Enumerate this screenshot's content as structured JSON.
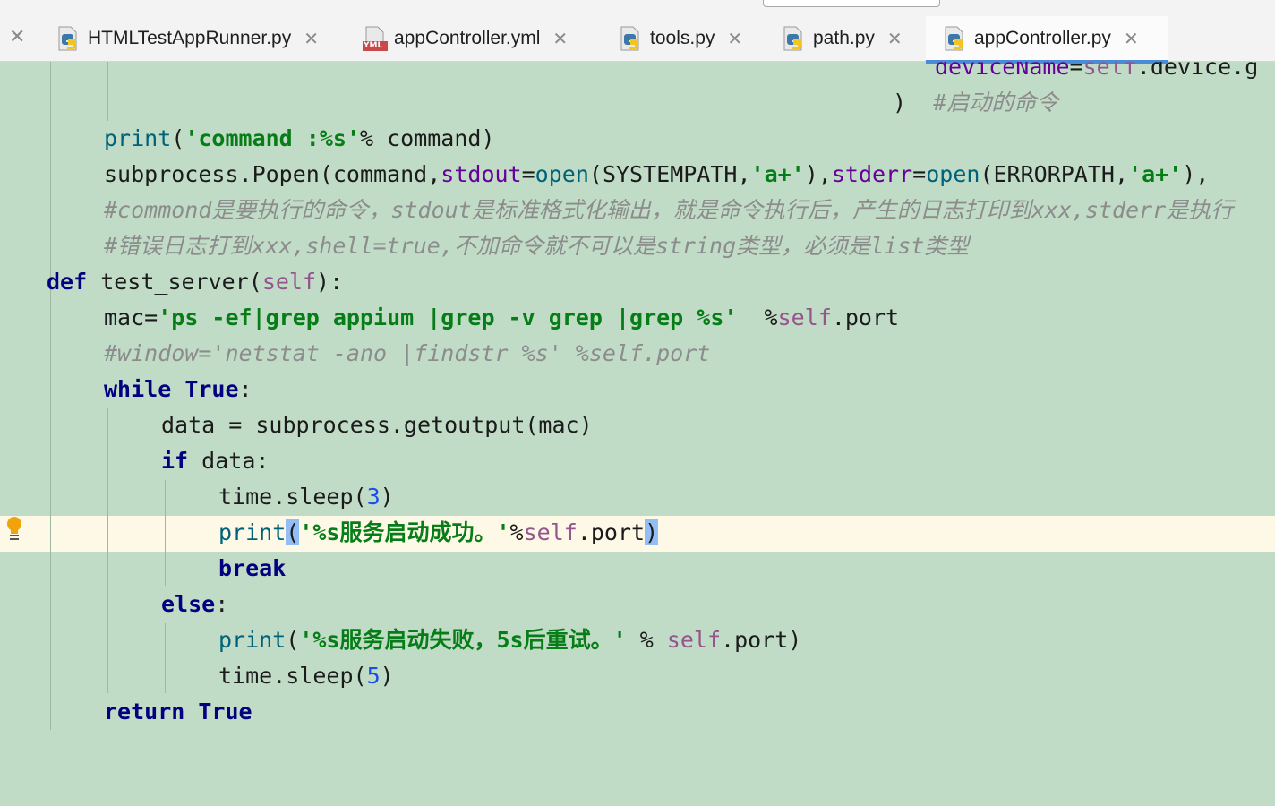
{
  "tabs": [
    {
      "label": "HTMLTestAppRunner.py",
      "icon": "python-file-icon",
      "active": false
    },
    {
      "label": "appController.yml",
      "icon": "yml-file-icon",
      "icon_text": "YML",
      "active": false
    },
    {
      "label": "tools.py",
      "icon": "python-file-icon",
      "active": false
    },
    {
      "label": "path.py",
      "icon": "python-file-icon",
      "active": false
    },
    {
      "label": "appController.py",
      "icon": "python-file-icon",
      "active": true
    }
  ],
  "code": {
    "l1_head": "deviceName",
    "l1_eq": "=",
    "l1_self": "self",
    "l1_tail": ".device.g",
    "l2_paren": ")",
    "l2_comment": "#启动的命令",
    "l3_print": "print",
    "l3_open": "(",
    "l3_str": "'command :%s'",
    "l3_tail": "% command)",
    "l4_a": "subprocess.Popen(command,",
    "l4_stdout": "stdout",
    "l4_eq1": "=",
    "l4_open1": "open",
    "l4_b": "(SYSTEMPATH,",
    "l4_s1": "'a+'",
    "l4_c": "),",
    "l4_stderr": "stderr",
    "l4_eq2": "=",
    "l4_open2": "open",
    "l4_d": "(ERRORPATH,",
    "l4_s2": "'a+'",
    "l4_e": "),",
    "l5_comment": "#commond是要执行的命令，stdout是标准格式化输出，就是命令执行后，产生的日志打印到xxx,stderr是执行",
    "l6_comment": "#错误日志打到xxx,shell=true,不加命令就不可以是string类型，必须是list类型",
    "l7_def": "def",
    "l7_name": " test_server(",
    "l7_self": "self",
    "l7_end": "):",
    "l8_a": "mac=",
    "l8_str": "'ps -ef|grep appium |grep -v grep |grep %s'",
    "l8_b": "  %",
    "l8_self": "self",
    "l8_c": ".port",
    "l9_comment": "#window='netstat -ano |findstr %s' %self.port",
    "l10_while": "while",
    "l10_true": "True",
    "l10_colon": ":",
    "l11": "data = subprocess.getoutput(mac)",
    "l12_if": "if",
    "l12_rest": " data:",
    "l13_a": "time.sleep(",
    "l13_num": "3",
    "l13_b": ")",
    "l14_print": "print",
    "l14_open": "(",
    "l14_str": "'%s服务启动成功。'",
    "l14_pct": "%",
    "l14_self": "self",
    "l14_port": ".port",
    "l14_close": ")",
    "l15_break": "break",
    "l16_else": "else",
    "l16_colon": ":",
    "l17_print": "print",
    "l17_open": "(",
    "l17_str": "'%s服务启动失败，5s后重试。'",
    "l17_pct": " % ",
    "l17_self": "self",
    "l17_port": ".port)",
    "l18_a": "time.sleep(",
    "l18_num": "5",
    "l18_b": ")",
    "l19_return": "return",
    "l19_true": "True"
  },
  "colors": {
    "editor_bg": "#C1DCC6",
    "current_line": "#FEF9E6",
    "keyword": "#000080",
    "string": "#067D17",
    "comment": "#8C8C8C",
    "self": "#94558D",
    "number": "#1750EB",
    "function": "#00627A",
    "tab_underline": "#4A8BD8"
  }
}
